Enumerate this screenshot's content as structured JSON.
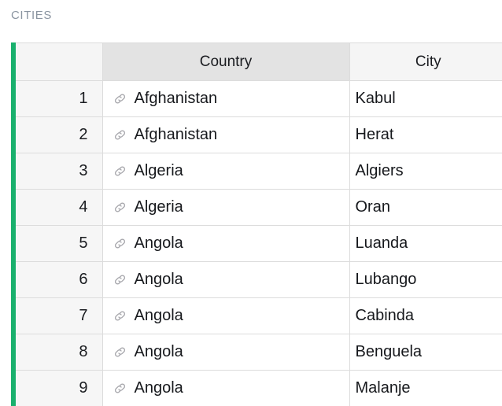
{
  "section": {
    "title": "CITIES"
  },
  "accent_color": "#19b06d",
  "table": {
    "columns": [
      {
        "key": "num",
        "label": "",
        "align": "right"
      },
      {
        "key": "country",
        "label": "Country",
        "align": "center"
      },
      {
        "key": "city",
        "label": "City",
        "align": "center"
      }
    ],
    "row_icon": "link-icon",
    "rows": [
      {
        "num": "1",
        "country": "Afghanistan",
        "city": "Kabul"
      },
      {
        "num": "2",
        "country": "Afghanistan",
        "city": "Herat"
      },
      {
        "num": "3",
        "country": "Algeria",
        "city": "Algiers"
      },
      {
        "num": "4",
        "country": "Algeria",
        "city": "Oran"
      },
      {
        "num": "5",
        "country": "Angola",
        "city": "Luanda"
      },
      {
        "num": "6",
        "country": "Angola",
        "city": "Lubango"
      },
      {
        "num": "7",
        "country": "Angola",
        "city": "Cabinda"
      },
      {
        "num": "8",
        "country": "Angola",
        "city": "Benguela"
      },
      {
        "num": "9",
        "country": "Angola",
        "city": "Malanje"
      }
    ]
  }
}
